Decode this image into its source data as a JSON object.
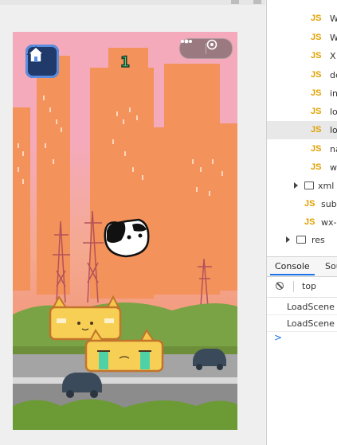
{
  "game": {
    "score": "1",
    "home_icon": "home-icon",
    "menu_icon": "more-dots-icon",
    "close_icon": "capsule-close-icon",
    "colors": {
      "sky": "#f4aabb",
      "buildings": "#f3925b",
      "ground": "#6f9a3a",
      "road": "#9a9a9a"
    }
  },
  "devtools": {
    "files": [
      {
        "type": "js",
        "name": "W",
        "selected": false
      },
      {
        "type": "js",
        "name": "W",
        "selected": false
      },
      {
        "type": "js",
        "name": "X",
        "selected": false
      },
      {
        "type": "js",
        "name": "de",
        "selected": false
      },
      {
        "type": "js",
        "name": "in",
        "selected": false
      },
      {
        "type": "js",
        "name": "lo",
        "selected": false
      },
      {
        "type": "js",
        "name": "lo",
        "selected": true
      },
      {
        "type": "js",
        "name": "na",
        "selected": false
      },
      {
        "type": "js",
        "name": "w",
        "selected": false
      },
      {
        "type": "folder",
        "name": "xml",
        "selected": false
      },
      {
        "type": "js",
        "name": "sub",
        "selected": false
      },
      {
        "type": "js",
        "name": "wx-",
        "selected": false
      },
      {
        "type": "folder",
        "name": "res",
        "selected": false
      }
    ],
    "tabs": [
      {
        "label": "Console"
      },
      {
        "label": "Sou"
      }
    ],
    "context": "top",
    "logs": [
      "LoadScene",
      "LoadScene"
    ],
    "prompt": ">"
  }
}
